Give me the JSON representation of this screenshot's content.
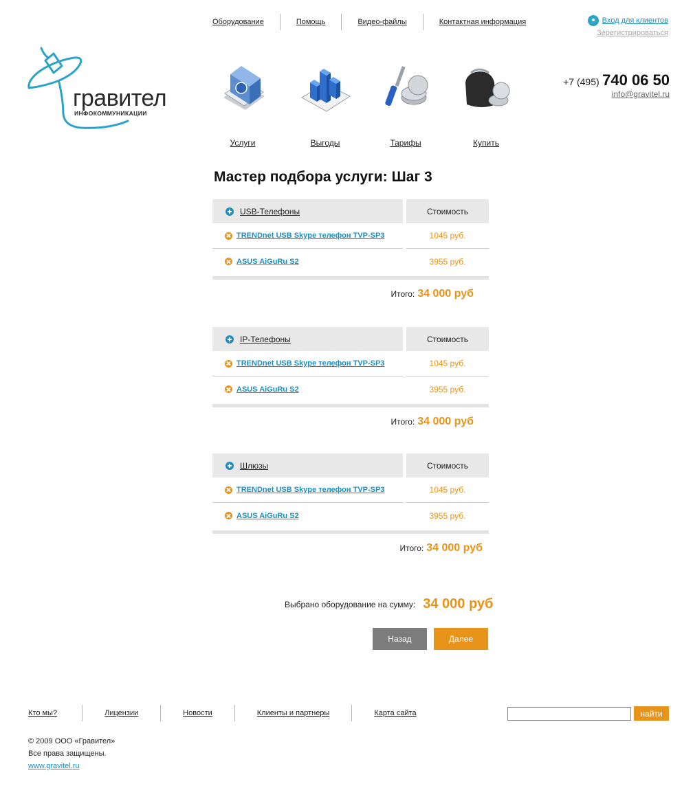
{
  "top_nav": [
    "Оборудование",
    "Помощь",
    "Видео-файлы",
    "Контактная информация"
  ],
  "login": {
    "enter_label": "Вход для клиентов",
    "register_label": "Зерегистрироваться"
  },
  "contacts": {
    "prefix": "+7 (495)",
    "number": "740 06 50",
    "email": "info@gravitel.ru"
  },
  "logo": {
    "word": "гравител",
    "sub": "ИНФОКОММУНИКАЦИИ"
  },
  "icon_nav": [
    {
      "label": "Услуги",
      "icon": "services-book-icon"
    },
    {
      "label": "Выгоды",
      "icon": "benefits-chart-icon"
    },
    {
      "label": "Тарифы",
      "icon": "tariffs-tools-coins-icon"
    },
    {
      "label": "Купить",
      "icon": "buy-wallet-icon"
    }
  ],
  "heading": {
    "title": "Мастер подбора услуги:",
    "step": "Шаг 3"
  },
  "cost_header": "Стоимость",
  "total_label": "Итого:",
  "groups": [
    {
      "title": "USB-Телефоны",
      "total": "34 000 руб",
      "items": [
        {
          "name": "TRENDnet USB Skype телефон TVP-SP3",
          "price": "1045 руб."
        },
        {
          "name": "ASUS AiGuRu S2",
          "price": "3955 руб."
        }
      ]
    },
    {
      "title": "IP-Телефоны",
      "total": "34 000 руб",
      "items": [
        {
          "name": "TRENDnet USB Skype телефон TVP-SP3",
          "price": "1045 руб."
        },
        {
          "name": "ASUS AiGuRu S2",
          "price": "3955 руб."
        }
      ]
    },
    {
      "title": "Шлюзы",
      "total": "34 000 руб",
      "items": [
        {
          "name": "TRENDnet USB Skype телефон TVP-SP3",
          "price": "1045 руб."
        },
        {
          "name": "ASUS AiGuRu S2",
          "price": "3955 руб."
        }
      ]
    }
  ],
  "summary": {
    "label": "Выбрано оборудование на сумму:",
    "value": "34 000 руб"
  },
  "buttons": {
    "back": "Назад",
    "next": "Далее"
  },
  "footer_nav": [
    "Кто мы?",
    "Лицензии",
    "Новости",
    "Клиенты и партнеры",
    "Карта сайта"
  ],
  "search": {
    "placeholder": "",
    "button": "найти"
  },
  "copyright": {
    "line1": "© 2009 ООО «Гравител»",
    "line2": "Все права защищены.",
    "site": "www.gravitel.ru"
  },
  "colors": {
    "accent": "#e8941a",
    "link": "#1a8fc0",
    "logo": "#2aa3c9"
  }
}
